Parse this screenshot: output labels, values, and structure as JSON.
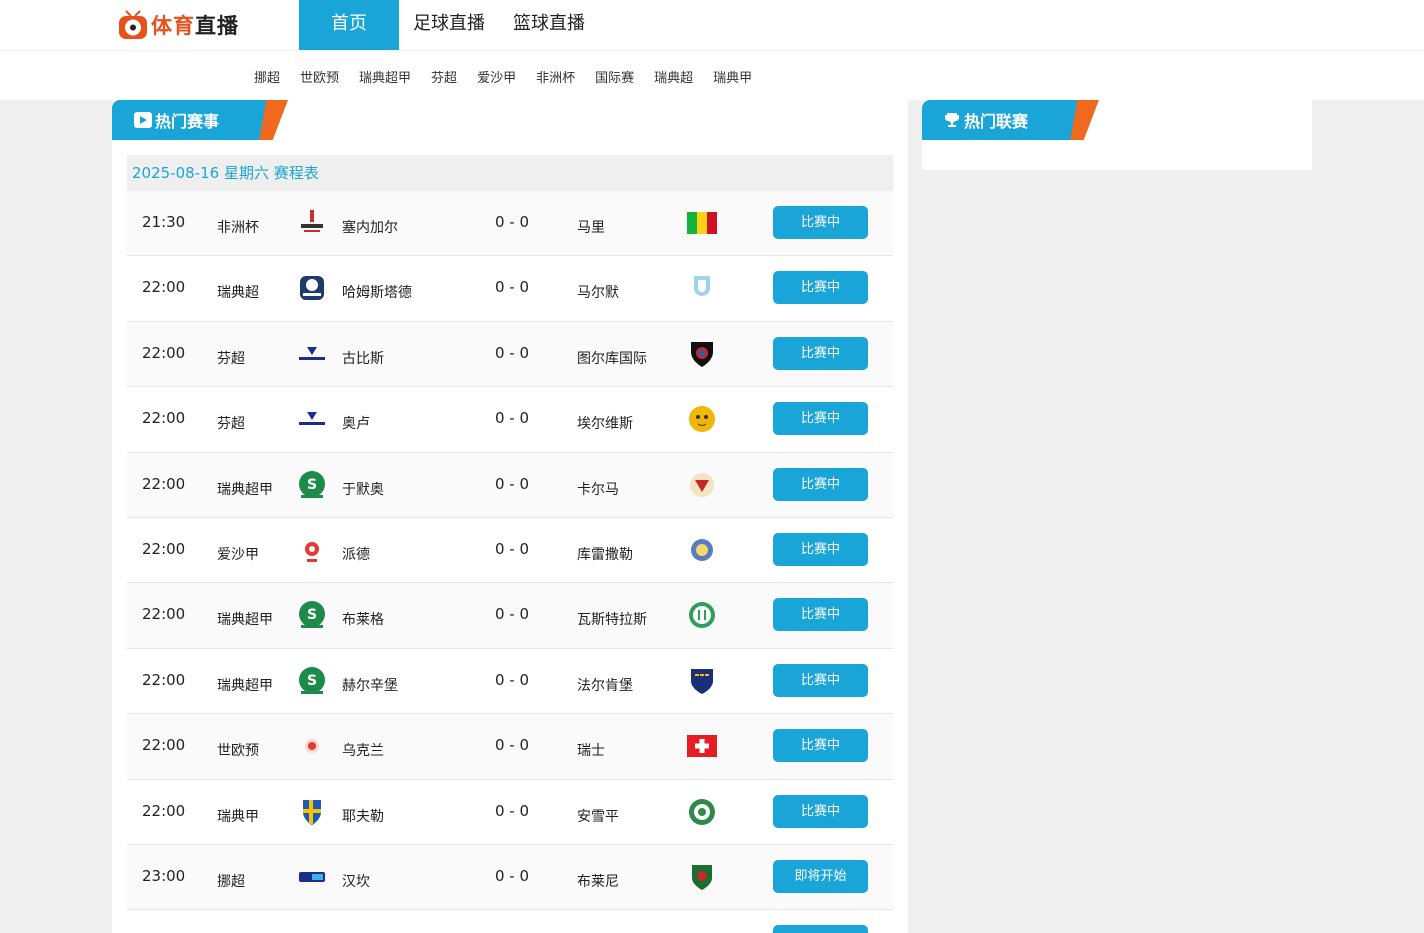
{
  "brand": {
    "name_orange": "体育",
    "name_dark": "直播",
    "accent": "#1aa5d8",
    "orange": "#ef6a1f"
  },
  "mainnav": [
    "首页",
    "足球直播",
    "篮球直播"
  ],
  "subnav": [
    "挪超",
    "世欧预",
    "瑞典超甲",
    "芬超",
    "爱沙甲",
    "非洲杯",
    "国际赛",
    "瑞典超",
    "瑞典甲"
  ],
  "hot_matches": {
    "title": "热门赛事",
    "date_header": "2025-08-16 星期六 赛程表"
  },
  "hot_leagues": {
    "title": "热门联赛"
  },
  "matches": [
    {
      "time": "21:30",
      "league": "非洲杯",
      "home": "塞内加尔",
      "score": "0 - 0",
      "away": "马里",
      "status": "比赛中",
      "home_icon": "chan-trophy-icon",
      "away_icon": "mali-flag-icon"
    },
    {
      "time": "22:00",
      "league": "瑞典超",
      "home": "哈姆斯塔德",
      "score": "0 - 0",
      "away": "马尔默",
      "status": "比赛中",
      "home_icon": "allsvenskan-icon",
      "away_icon": "malmo-crest-icon"
    },
    {
      "time": "22:00",
      "league": "芬超",
      "home": "古比斯",
      "score": "0 - 0",
      "away": "图尔库国际",
      "status": "比赛中",
      "home_icon": "veikkausliiga-icon",
      "away_icon": "inter-turku-crest-icon"
    },
    {
      "time": "22:00",
      "league": "芬超",
      "home": "奥卢",
      "score": "0 - 0",
      "away": "埃尔维斯",
      "status": "比赛中",
      "home_icon": "veikkausliiga-icon",
      "away_icon": "ilves-crest-icon"
    },
    {
      "time": "22:00",
      "league": "瑞典超甲",
      "home": "于默奥",
      "score": "0 - 0",
      "away": "卡尔马",
      "status": "比赛中",
      "home_icon": "superettan-icon",
      "away_icon": "kalmar-crest-icon"
    },
    {
      "time": "22:00",
      "league": "爱沙甲",
      "home": "派德",
      "score": "0 - 0",
      "away": "库雷撒勒",
      "status": "比赛中",
      "home_icon": "paide-crest-icon",
      "away_icon": "kuressaare-crest-icon"
    },
    {
      "time": "22:00",
      "league": "瑞典超甲",
      "home": "布莱格",
      "score": "0 - 0",
      "away": "瓦斯特拉斯",
      "status": "比赛中",
      "home_icon": "superettan-icon",
      "away_icon": "vasteras-crest-icon"
    },
    {
      "time": "22:00",
      "league": "瑞典超甲",
      "home": "赫尔辛堡",
      "score": "0 - 0",
      "away": "法尔肯堡",
      "status": "比赛中",
      "home_icon": "superettan-icon",
      "away_icon": "falkenberg-crest-icon"
    },
    {
      "time": "22:00",
      "league": "世欧预",
      "home": "乌克兰",
      "score": "0 - 0",
      "away": "瑞士",
      "status": "比赛中",
      "home_icon": "ukraine-crest-icon",
      "away_icon": "swiss-flag-icon"
    },
    {
      "time": "22:00",
      "league": "瑞典甲",
      "home": "耶夫勒",
      "score": "0 - 0",
      "away": "安雪平",
      "status": "比赛中",
      "home_icon": "sweden-crest-icon",
      "away_icon": "linkoping-crest-icon"
    },
    {
      "time": "23:00",
      "league": "挪超",
      "home": "汉坎",
      "score": "0 - 0",
      "away": "布莱尼",
      "status": "即将开始",
      "home_icon": "eliteserien-icon",
      "away_icon": "bryne-crest-icon"
    },
    {
      "time": "",
      "league": "",
      "home": "",
      "score": "",
      "away": "",
      "status": "",
      "home_icon": "",
      "away_icon": ""
    }
  ]
}
